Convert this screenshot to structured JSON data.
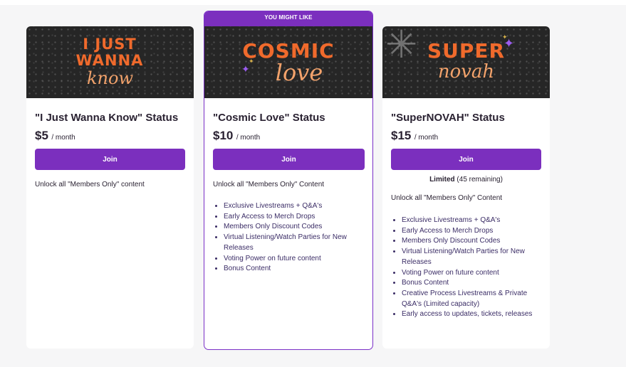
{
  "tiers": [
    {
      "title": "\"I Just Wanna Know\" Status",
      "price": "$5",
      "period": "/ month",
      "join_label": "Join",
      "banner_line1": "I JUST WANNA",
      "banner_line2": "know",
      "description": "Unlock all \"Members Only\" content"
    },
    {
      "ribbon": "YOU MIGHT LIKE",
      "title": "\"Cosmic Love\" Status",
      "price": "$10",
      "period": "/ month",
      "join_label": "Join",
      "banner_line1": "COSMIC",
      "banner_line2": "love",
      "description": "Unlock all \"Members Only\" Content",
      "perks": [
        "Exclusive Livestreams + Q&A's",
        "Early Access to Merch Drops",
        "Members Only Discount Codes",
        "Virtual Listening/Watch Parties for New Releases",
        "Voting Power on future content",
        "Bonus Content"
      ]
    },
    {
      "title": "\"SuperNOVAH\" Status",
      "price": "$15",
      "period": "/ month",
      "join_label": "Join",
      "banner_line1": "SUPER",
      "banner_line2": "novah",
      "limited_label": "Limited",
      "limited_remaining": "(45 remaining)",
      "description": "Unlock all \"Members Only\" Content",
      "perks": [
        "Exclusive Livestreams + Q&A's",
        "Early Access to Merch Drops",
        "Members Only Discount Codes",
        "Virtual Listening/Watch Parties for New Releases",
        "Voting Power on future content",
        "Bonus Content",
        "Creative Process Livestreams & Private Q&A's (Limited capacity)",
        "Early access to updates, tickets, releases"
      ]
    }
  ],
  "colors": {
    "accent": "#7b2fbe",
    "banner_orange": "#f06a2c",
    "banner_peach": "#f2a26b",
    "sparkle": "#9b5cf0"
  }
}
